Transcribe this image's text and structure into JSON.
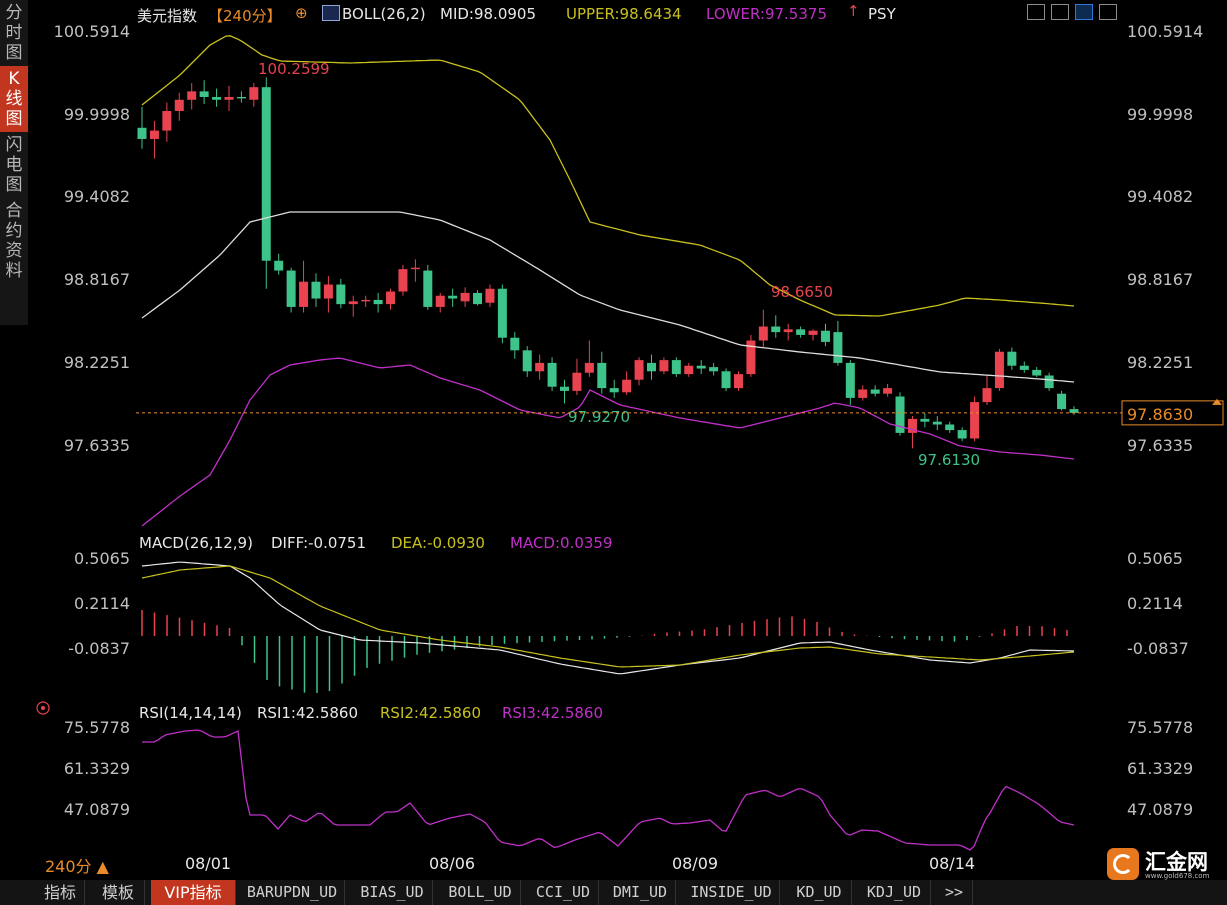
{
  "sidebar": {
    "items": [
      {
        "label": "分时图",
        "active": false
      },
      {
        "label": "K线图",
        "active": true
      },
      {
        "label": "闪电图",
        "active": false
      },
      {
        "label": "合约资料",
        "active": false
      }
    ]
  },
  "header": {
    "symbol": "美元指数",
    "period_tag": "【240分】",
    "add_icon": "⊕",
    "boll_label": "BOLL(26,2)",
    "mid": "MID:98.0905",
    "upper": "UPPER:98.6434",
    "lower": "LOWER:97.5375",
    "psy": "PSY"
  },
  "price_axis": {
    "ticks": [
      "100.5914",
      "99.9998",
      "99.4082",
      "98.8167",
      "98.2251",
      "97.6335"
    ]
  },
  "price_annotations": {
    "high": "100.2599",
    "peak2": "98.6650",
    "low1": "97.9270",
    "low2": "97.6130"
  },
  "current_price": "97.8630",
  "macd": {
    "label": "MACD(26,12,9)",
    "diff": "DIFF:-0.0751",
    "dea": "DEA:-0.0930",
    "macd": "MACD:0.0359",
    "ticks": [
      "0.5065",
      "0.2114",
      "-0.0837"
    ]
  },
  "rsi": {
    "label": "RSI(14,14,14)",
    "rsi1": "RSI1:42.5860",
    "rsi2": "RSI2:42.5860",
    "rsi3": "RSI3:42.5860",
    "ticks": [
      "75.5778",
      "61.3329",
      "47.0879"
    ]
  },
  "period_selector": "240分 ▲",
  "dates": [
    "08/01",
    "08/06",
    "08/09",
    "08/14"
  ],
  "bottom_tabs": [
    "指标",
    "模板",
    "VIP指标",
    "BARUPDN_UD",
    "BIAS_UD",
    "BOLL_UD",
    "CCI_UD",
    "DMI_UD",
    "INSIDE_UD",
    "KD_UD",
    "KDJ_UD",
    ">>"
  ],
  "logo": {
    "name": "汇金网",
    "url": "www.gold678.com"
  },
  "colors": {
    "up": "#e8434f",
    "down": "#3ec38a",
    "upper": "#c8c11e",
    "mid": "#dddddd",
    "lower": "#c030c8",
    "axis": "#c0c0c0"
  },
  "chart_data": {
    "type": "candlestick",
    "series": [
      {
        "o": 99.9,
        "h": 100.05,
        "l": 99.75,
        "c": 99.82
      },
      {
        "o": 99.82,
        "h": 99.95,
        "l": 99.68,
        "c": 99.88
      },
      {
        "o": 99.88,
        "h": 100.08,
        "l": 99.8,
        "c": 100.02
      },
      {
        "o": 100.02,
        "h": 100.15,
        "l": 99.95,
        "c": 100.1
      },
      {
        "o": 100.1,
        "h": 100.22,
        "l": 100.03,
        "c": 100.16
      },
      {
        "o": 100.16,
        "h": 100.24,
        "l": 100.07,
        "c": 100.12
      },
      {
        "o": 100.12,
        "h": 100.18,
        "l": 100.05,
        "c": 100.1
      },
      {
        "o": 100.1,
        "h": 100.2,
        "l": 100.02,
        "c": 100.12
      },
      {
        "o": 100.12,
        "h": 100.16,
        "l": 100.08,
        "c": 100.11
      },
      {
        "o": 100.1,
        "h": 100.22,
        "l": 100.05,
        "c": 100.19
      },
      {
        "o": 100.19,
        "h": 100.26,
        "l": 98.75,
        "c": 98.95
      },
      {
        "o": 98.95,
        "h": 99.0,
        "l": 98.85,
        "c": 98.88
      },
      {
        "o": 98.88,
        "h": 98.9,
        "l": 98.58,
        "c": 98.62
      },
      {
        "o": 98.62,
        "h": 98.95,
        "l": 98.58,
        "c": 98.8
      },
      {
        "o": 98.8,
        "h": 98.86,
        "l": 98.62,
        "c": 98.68
      },
      {
        "o": 98.68,
        "h": 98.84,
        "l": 98.58,
        "c": 98.78
      },
      {
        "o": 98.78,
        "h": 98.82,
        "l": 98.61,
        "c": 98.64
      },
      {
        "o": 98.64,
        "h": 98.7,
        "l": 98.55,
        "c": 98.66
      },
      {
        "o": 98.66,
        "h": 98.7,
        "l": 98.62,
        "c": 98.67
      },
      {
        "o": 98.67,
        "h": 98.72,
        "l": 98.58,
        "c": 98.64
      },
      {
        "o": 98.64,
        "h": 98.75,
        "l": 98.6,
        "c": 98.73
      },
      {
        "o": 98.73,
        "h": 98.92,
        "l": 98.7,
        "c": 98.89
      },
      {
        "o": 98.89,
        "h": 98.96,
        "l": 98.8,
        "c": 98.9
      },
      {
        "o": 98.88,
        "h": 98.92,
        "l": 98.6,
        "c": 98.62
      },
      {
        "o": 98.62,
        "h": 98.72,
        "l": 98.58,
        "c": 98.7
      },
      {
        "o": 98.7,
        "h": 98.75,
        "l": 98.62,
        "c": 98.68
      },
      {
        "o": 98.66,
        "h": 98.76,
        "l": 98.62,
        "c": 98.72
      },
      {
        "o": 98.72,
        "h": 98.74,
        "l": 98.63,
        "c": 98.64
      },
      {
        "o": 98.65,
        "h": 98.78,
        "l": 98.62,
        "c": 98.75
      },
      {
        "o": 98.75,
        "h": 98.78,
        "l": 98.36,
        "c": 98.4
      },
      {
        "o": 98.4,
        "h": 98.44,
        "l": 98.25,
        "c": 98.31
      },
      {
        "o": 98.31,
        "h": 98.34,
        "l": 98.12,
        "c": 98.16
      },
      {
        "o": 98.16,
        "h": 98.28,
        "l": 98.1,
        "c": 98.22
      },
      {
        "o": 98.22,
        "h": 98.26,
        "l": 98.02,
        "c": 98.05
      },
      {
        "o": 98.05,
        "h": 98.1,
        "l": 97.93,
        "c": 98.02
      },
      {
        "o": 98.02,
        "h": 98.25,
        "l": 97.99,
        "c": 98.15
      },
      {
        "o": 98.15,
        "h": 98.38,
        "l": 98.12,
        "c": 98.22
      },
      {
        "o": 98.22,
        "h": 98.3,
        "l": 98.0,
        "c": 98.04
      },
      {
        "o": 98.04,
        "h": 98.1,
        "l": 97.97,
        "c": 98.01
      },
      {
        "o": 98.01,
        "h": 98.16,
        "l": 97.99,
        "c": 98.1
      },
      {
        "o": 98.1,
        "h": 98.26,
        "l": 98.06,
        "c": 98.24
      },
      {
        "o": 98.22,
        "h": 98.28,
        "l": 98.1,
        "c": 98.16
      },
      {
        "o": 98.16,
        "h": 98.26,
        "l": 98.14,
        "c": 98.24
      },
      {
        "o": 98.24,
        "h": 98.26,
        "l": 98.12,
        "c": 98.14
      },
      {
        "o": 98.14,
        "h": 98.22,
        "l": 98.12,
        "c": 98.2
      },
      {
        "o": 98.2,
        "h": 98.24,
        "l": 98.14,
        "c": 98.18
      },
      {
        "o": 98.19,
        "h": 98.22,
        "l": 98.13,
        "c": 98.16
      },
      {
        "o": 98.16,
        "h": 98.18,
        "l": 98.02,
        "c": 98.04
      },
      {
        "o": 98.04,
        "h": 98.16,
        "l": 98.02,
        "c": 98.14
      },
      {
        "o": 98.14,
        "h": 98.42,
        "l": 98.12,
        "c": 98.38
      },
      {
        "o": 98.38,
        "h": 98.6,
        "l": 98.33,
        "c": 98.48
      },
      {
        "o": 98.48,
        "h": 98.56,
        "l": 98.4,
        "c": 98.44
      },
      {
        "o": 98.44,
        "h": 98.5,
        "l": 98.38,
        "c": 98.46
      },
      {
        "o": 98.46,
        "h": 98.48,
        "l": 98.4,
        "c": 98.42
      },
      {
        "o": 98.42,
        "h": 98.46,
        "l": 98.38,
        "c": 98.45
      },
      {
        "o": 98.45,
        "h": 98.5,
        "l": 98.34,
        "c": 98.37
      },
      {
        "o": 98.44,
        "h": 98.52,
        "l": 98.2,
        "c": 98.22
      },
      {
        "o": 98.22,
        "h": 98.24,
        "l": 97.92,
        "c": 97.97
      },
      {
        "o": 97.97,
        "h": 98.06,
        "l": 97.95,
        "c": 98.03
      },
      {
        "o": 98.03,
        "h": 98.06,
        "l": 97.98,
        "c": 98.0
      },
      {
        "o": 98.0,
        "h": 98.07,
        "l": 97.98,
        "c": 98.04
      },
      {
        "o": 97.98,
        "h": 98.01,
        "l": 97.7,
        "c": 97.72
      },
      {
        "o": 97.72,
        "h": 97.84,
        "l": 97.61,
        "c": 97.82
      },
      {
        "o": 97.82,
        "h": 97.86,
        "l": 97.76,
        "c": 97.8
      },
      {
        "o": 97.8,
        "h": 97.84,
        "l": 97.74,
        "c": 97.78
      },
      {
        "o": 97.78,
        "h": 97.8,
        "l": 97.72,
        "c": 97.74
      },
      {
        "o": 97.74,
        "h": 97.76,
        "l": 97.66,
        "c": 97.68
      },
      {
        "o": 97.68,
        "h": 97.98,
        "l": 97.66,
        "c": 97.94
      },
      {
        "o": 97.94,
        "h": 98.14,
        "l": 97.92,
        "c": 98.04
      },
      {
        "o": 98.04,
        "h": 98.32,
        "l": 98.02,
        "c": 98.3
      },
      {
        "o": 98.3,
        "h": 98.33,
        "l": 98.17,
        "c": 98.2
      },
      {
        "o": 98.2,
        "h": 98.23,
        "l": 98.15,
        "c": 98.17
      },
      {
        "o": 98.17,
        "h": 98.19,
        "l": 98.12,
        "c": 98.13
      },
      {
        "o": 98.13,
        "h": 98.15,
        "l": 98.02,
        "c": 98.04
      },
      {
        "o": 98.0,
        "h": 98.02,
        "l": 97.88,
        "c": 97.89
      },
      {
        "o": 97.89,
        "h": 97.91,
        "l": 97.85,
        "c": 97.863
      }
    ]
  }
}
